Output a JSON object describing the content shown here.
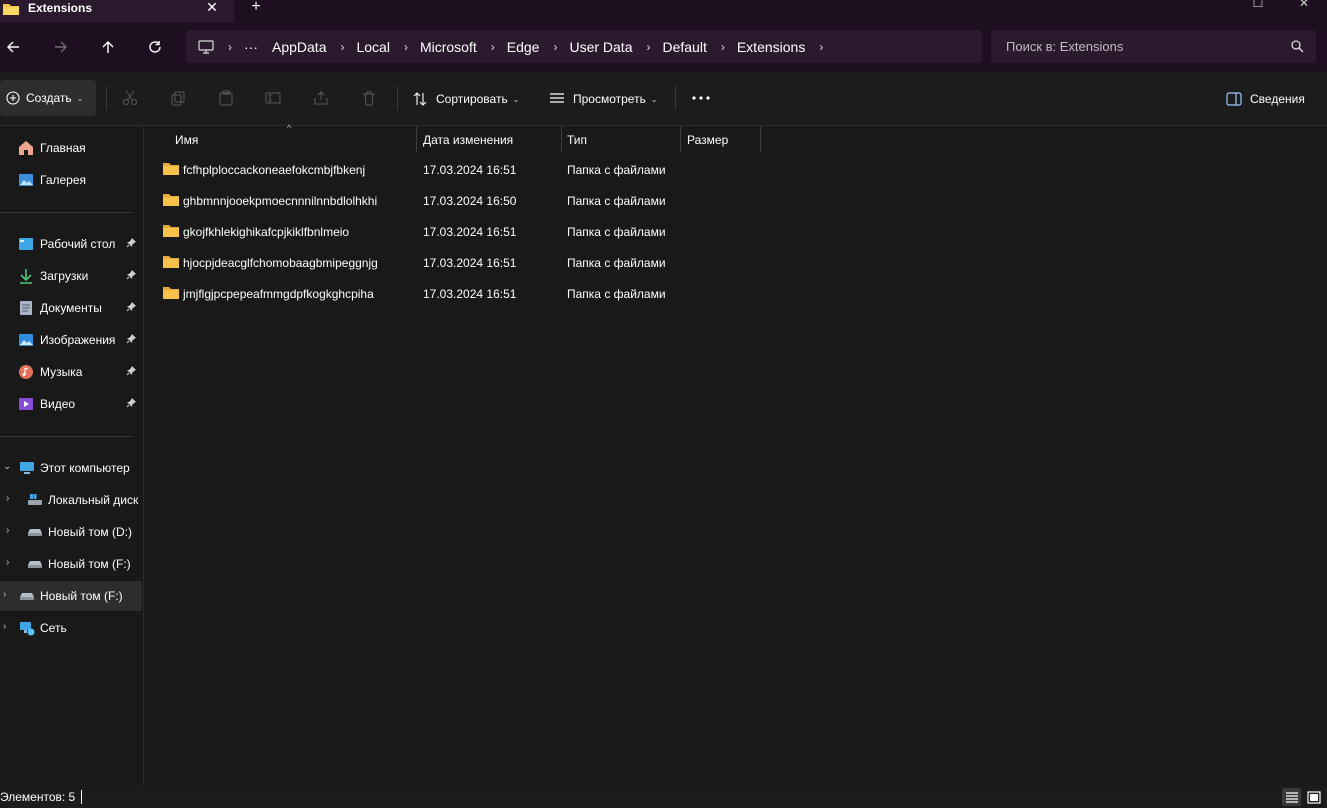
{
  "tab": {
    "title": "Extensions",
    "close": "✕",
    "new_tab": "+"
  },
  "window_controls": {
    "minimize": "─",
    "maximize": "☐",
    "close": "✕"
  },
  "navigation": {
    "back_icon": "arrow-left-icon",
    "forward_icon": "arrow-right-icon",
    "up_icon": "arrow-up-icon",
    "refresh_icon": "refresh-icon"
  },
  "breadcrumb": {
    "root_icon": "computer-icon",
    "overflow": "···",
    "items": [
      "AppData",
      "Local",
      "Microsoft",
      "Edge",
      "User Data",
      "Default",
      "Extensions"
    ]
  },
  "search": {
    "placeholder": "Поиск в: Extensions"
  },
  "toolbar": {
    "create_label": "Создать",
    "sort_label": "Сортировать",
    "view_label": "Просмотреть",
    "more_label": "•••",
    "details_label": "Сведения",
    "disabled_actions": [
      "cut-icon",
      "copy-icon",
      "paste-icon",
      "rename-icon",
      "share-icon",
      "delete-icon"
    ]
  },
  "sidebar": {
    "quick": [
      {
        "label": "Главная",
        "icon": "home-icon"
      },
      {
        "label": "Галерея",
        "icon": "gallery-icon"
      }
    ],
    "pinned": [
      {
        "label": "Рабочий стол",
        "icon": "desktop-icon"
      },
      {
        "label": "Загрузки",
        "icon": "downloads-icon"
      },
      {
        "label": "Документы",
        "icon": "documents-icon"
      },
      {
        "label": "Изображения",
        "icon": "pictures-icon"
      },
      {
        "label": "Музыка",
        "icon": "music-icon"
      },
      {
        "label": "Видео",
        "icon": "videos-icon"
      }
    ],
    "this_pc": {
      "label": "Этот компьютер",
      "icon": "computer-icon"
    },
    "drives": [
      {
        "label": "Локальный диск",
        "icon": "system-drive-icon"
      },
      {
        "label": "Новый том (D:)",
        "icon": "drive-icon"
      },
      {
        "label": "Новый том (F:)",
        "icon": "drive-icon"
      }
    ],
    "selected_drive": {
      "label": "Новый том (F:)",
      "icon": "drive-icon"
    },
    "network": {
      "label": "Сеть",
      "icon": "network-icon"
    }
  },
  "file_list": {
    "columns": [
      "Имя",
      "Дата изменения",
      "Тип",
      "Размер"
    ],
    "sort_indicator": "^",
    "rows": [
      {
        "name": "fcfhplploccackoneaefokcmbjfbkenj",
        "date": "17.03.2024 16:51",
        "type": "Папка с файлами"
      },
      {
        "name": "ghbmnnjooekpmoecnnnilnnbdlolhkhi",
        "date": "17.03.2024 16:50",
        "type": "Папка с файлами"
      },
      {
        "name": "gkojfkhlekighikafcpjkiklfbnlmeio",
        "date": "17.03.2024 16:51",
        "type": "Папка с файлами"
      },
      {
        "name": "hjocpjdeacglfchomobaagbmipeggnjg",
        "date": "17.03.2024 16:51",
        "type": "Папка с файлами"
      },
      {
        "name": "jmjflgjpcpepeafmmgdpfkogkghcpiha",
        "date": "17.03.2024 16:51",
        "type": "Папка с файлами"
      }
    ]
  },
  "status": {
    "items_text": "Элементов: 5"
  },
  "colors": {
    "titlebar": "#1d0f1f",
    "tab_active": "#2b1a2d",
    "background": "#191919",
    "folder": "#f8c24a"
  }
}
